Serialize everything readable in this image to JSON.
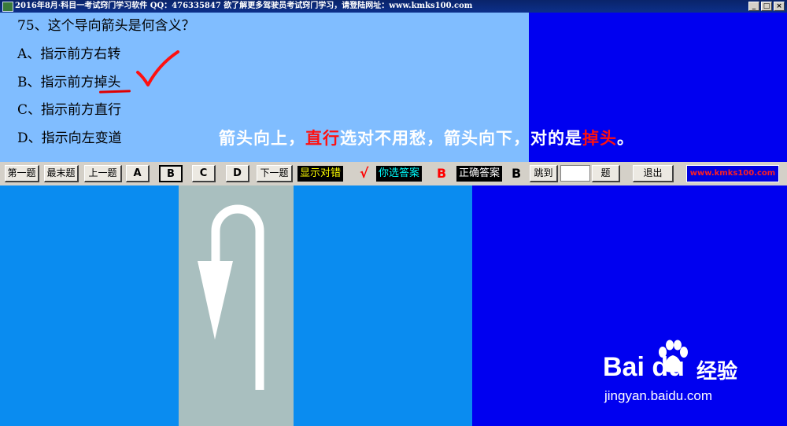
{
  "window": {
    "title": "2016年8月·科目一考试窍门学习软件  QQ：476335847 欲了解更多驾驶员考试窍门学习，请登陆网址：www.kmks100.com",
    "buttons": [
      "_",
      "□",
      "×"
    ]
  },
  "question": {
    "text": "75、这个导向箭头是何含义？",
    "options": [
      "A、指示前方右转",
      "B、指示前方掉头",
      "C、指示前方直行",
      "D、指示向左变道"
    ]
  },
  "caption": {
    "part1": "箭头向上，",
    "part2": "直行",
    "part3": "选对不用愁，箭头向下，对的是",
    "part4": "掉头",
    "part5": "。"
  },
  "toolbar": {
    "first": "第一题",
    "last": "最末题",
    "prev": "上一题",
    "a": "A",
    "b": "B",
    "c": "C",
    "d": "D",
    "next": "下一题",
    "show_result": "显示对错",
    "result_mark": "√",
    "your_answer_label": "你选答案",
    "your_answer": "B",
    "correct_label": "正确答案",
    "correct_answer": "B",
    "jump": "跳到",
    "question_unit": "题",
    "exit": "退出",
    "site": "www.kmks100.com"
  },
  "watermark": {
    "logo": "Bai  du",
    "brand": "经验",
    "url": "jingyan.baidu.com"
  },
  "colors": {
    "question_bg": "#80bdff",
    "block_blue": "#0000f0",
    "sign_bg": "#0a8cf0",
    "lane": "#a9bfbf",
    "highlight_red": "#ff1010"
  }
}
